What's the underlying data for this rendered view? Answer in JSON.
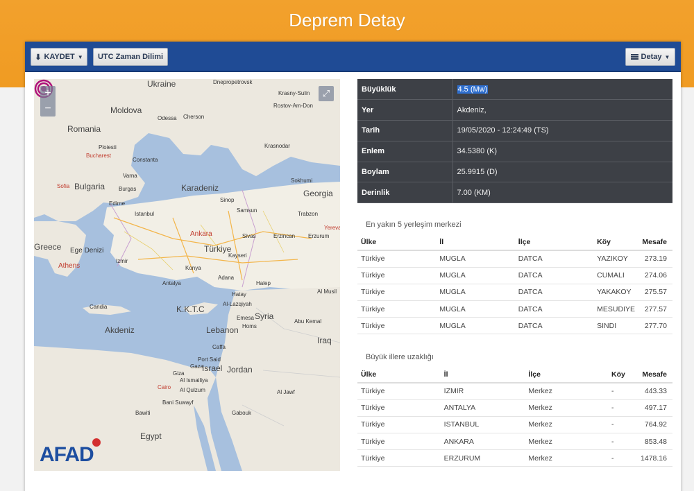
{
  "page": {
    "title": "Deprem Detay"
  },
  "toolbar": {
    "save_label": "KAYDET",
    "utc_label": "UTC Zaman Dilimi",
    "detail_label": "Detay"
  },
  "map": {
    "zoom_in": "+",
    "zoom_out": "−",
    "fullscreen": "⤢",
    "logo": "AFAD",
    "labels": {
      "ukraine": "Ukraine",
      "moldova": "Moldova",
      "romania": "Romania",
      "bulgaria": "Bulgaria",
      "karadeniz": "Karadeniz",
      "georgia": "Georgia",
      "turkiye": "Türkiye",
      "greece": "Greece",
      "ege": "Ege Denizi",
      "akdeniz": "Akdeniz",
      "kktc": "K.K.T.C",
      "syria": "Syria",
      "lebanon": "Lebanon",
      "israel": "Israel",
      "jordan": "Jordan",
      "iraq": "Iraq",
      "egypt": "Egypt",
      "ankara": "Ankara",
      "athens": "Athens",
      "bucharest": "Bucharest",
      "sofia": "Sofia",
      "cairo": "Cairo",
      "dnepro": "Dnepropetrovsk",
      "odessa": "Odessa",
      "cherson": "Cherson",
      "rostov": "Rostov-Am-Don",
      "krasny": "Krasny-Sulin",
      "krasnodar": "Krasnodar",
      "sochi": "Sokhumi",
      "trabzon": "Trabzon",
      "samsun": "Samsun",
      "sinop": "Sinop",
      "istanbul": "Istanbul",
      "izmir": "Izmir",
      "antalya": "Antalya",
      "konya": "Konya",
      "adana": "Adana",
      "kayseri": "Kayseri",
      "erzurum": "Erzurum",
      "erzincan": "Erzincan",
      "sivas": "Sivas",
      "yerevan": "Yerevan",
      "candia": "Candia",
      "ploiesti": "Ploiesti",
      "constanta": "Constanta",
      "varna": "Varna",
      "burgas": "Burgas",
      "edirne": "Edirne",
      "hatay": "Hatay",
      "halep": "Halep",
      "lazkiye": "Al-Lazqiyah",
      "humus": "Homs",
      "emesa": "Emesa",
      "akmusil": "Al Musil",
      "abukemal": "Abu Kemal",
      "caffa": "Caffa",
      "gaza": "Gaza",
      "ismailiya": "Al Ismailiya",
      "alqulzum": "Al Qulzum",
      "banisuwayf": "Bani Suwayf",
      "bawiti": "Bawiti",
      "gabouk": "Gabouk",
      "aljawf": "Al Jawf",
      "giza": "Giza",
      "portsaid": "Port Said"
    }
  },
  "info": {
    "rows": [
      {
        "key": "Büyüklük",
        "value": "4.5 (Mw)"
      },
      {
        "key": "Yer",
        "value": "Akdeniz,"
      },
      {
        "key": "Tarih",
        "value": "19/05/2020 - 12:24:49 (TS)"
      },
      {
        "key": "Enlem",
        "value": "34.5380 (K)"
      },
      {
        "key": "Boylam",
        "value": "25.9915 (D)"
      },
      {
        "key": "Derinlik",
        "value": "7.00 (KM)"
      }
    ]
  },
  "nearest": {
    "title": "En yakın 5 yerleşim merkezi",
    "headers": [
      "Ülke",
      "İl",
      "İlçe",
      "Köy",
      "Mesafe"
    ],
    "rows": [
      [
        "Türkiye",
        "MUGLA",
        "DATCA",
        "YAZIKOY",
        "273.19"
      ],
      [
        "Türkiye",
        "MUGLA",
        "DATCA",
        "CUMALI",
        "274.06"
      ],
      [
        "Türkiye",
        "MUGLA",
        "DATCA",
        "YAKAKOY",
        "275.57"
      ],
      [
        "Türkiye",
        "MUGLA",
        "DATCA",
        "MESUDIYE",
        "277.57"
      ],
      [
        "Türkiye",
        "MUGLA",
        "DATCA",
        "SINDI",
        "277.70"
      ]
    ]
  },
  "cities": {
    "title": "Büyük illere uzaklığı",
    "headers": [
      "Ülke",
      "İl",
      "İlçe",
      "Köy",
      "Mesafe"
    ],
    "rows": [
      [
        "Türkiye",
        "IZMIR",
        "Merkez",
        "-",
        "443.33"
      ],
      [
        "Türkiye",
        "ANTALYA",
        "Merkez",
        "-",
        "497.17"
      ],
      [
        "Türkiye",
        "ISTANBUL",
        "Merkez",
        "-",
        "764.92"
      ],
      [
        "Türkiye",
        "ANKARA",
        "Merkez",
        "-",
        "853.48"
      ],
      [
        "Türkiye",
        "ERZURUM",
        "Merkez",
        "-",
        "1478.16"
      ]
    ]
  },
  "colors": {
    "header_orange": "#f09b22",
    "toolbar_blue": "#1f4b95",
    "info_dark": "#3d4046",
    "highlight_blue": "#2f6fcf",
    "marker_magenta": "#b0127a"
  }
}
